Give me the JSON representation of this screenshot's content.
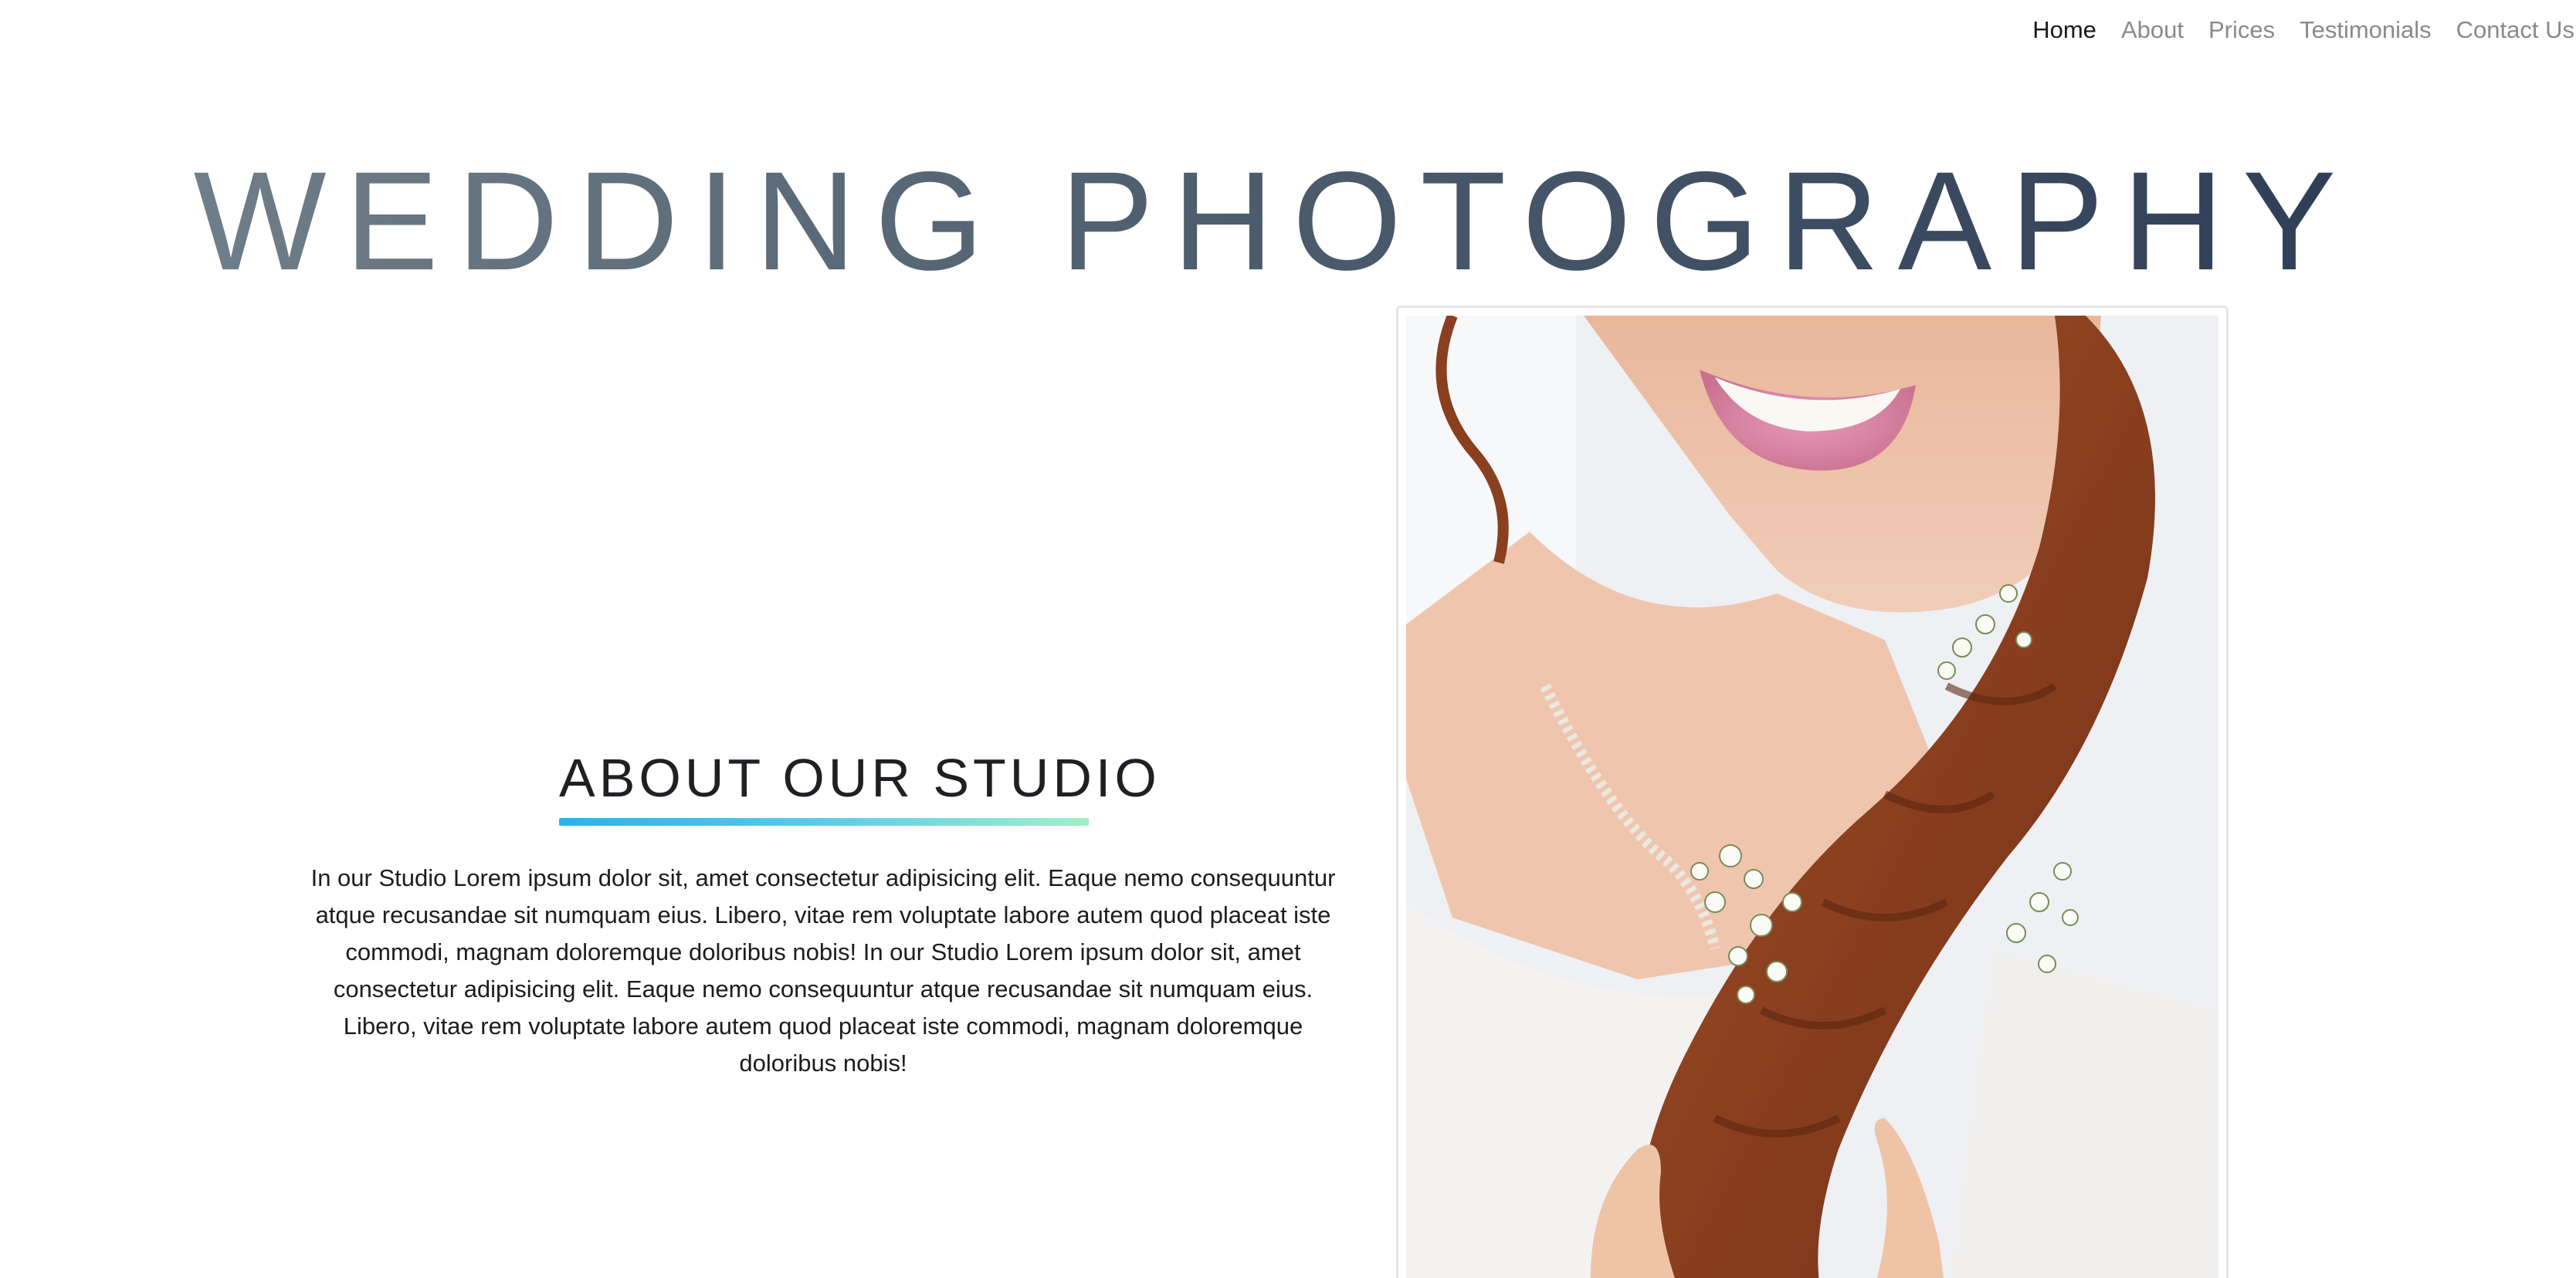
{
  "nav": {
    "items": [
      {
        "label": "Home",
        "active": true
      },
      {
        "label": "About",
        "active": false
      },
      {
        "label": "Prices",
        "active": false
      },
      {
        "label": "Testimonials",
        "active": false
      },
      {
        "label": "Contact Us",
        "active": false
      }
    ]
  },
  "hero": {
    "title": "WEDDING PHOTOGRAPHY"
  },
  "about": {
    "heading": "ABOUT OUR STUDIO",
    "body": "In our Studio Lorem ipsum dolor sit, amet consectetur adipisicing elit. Eaque nemo consequuntur atque recusandae sit numquam eius. Libero, vitae rem voluptate labore autem quod placeat iste commodi, magnam doloremque doloribus nobis! In our Studio Lorem ipsum dolor sit, amet consectetur adipisicing elit. Eaque nemo consequuntur atque recusandae sit numquam eius. Libero, vitae rem voluptate labore autem quod placeat iste commodi, magnam doloremque doloribus nobis!"
  },
  "colors": {
    "title_gradient_start": "#6f7e88",
    "title_gradient_end": "#2f3e57",
    "underline_gradient_start": "#26b3ee",
    "underline_gradient_end": "#9ff0c6",
    "nav_active": "#1a1a1a",
    "nav_inactive": "#8a8a8a"
  }
}
